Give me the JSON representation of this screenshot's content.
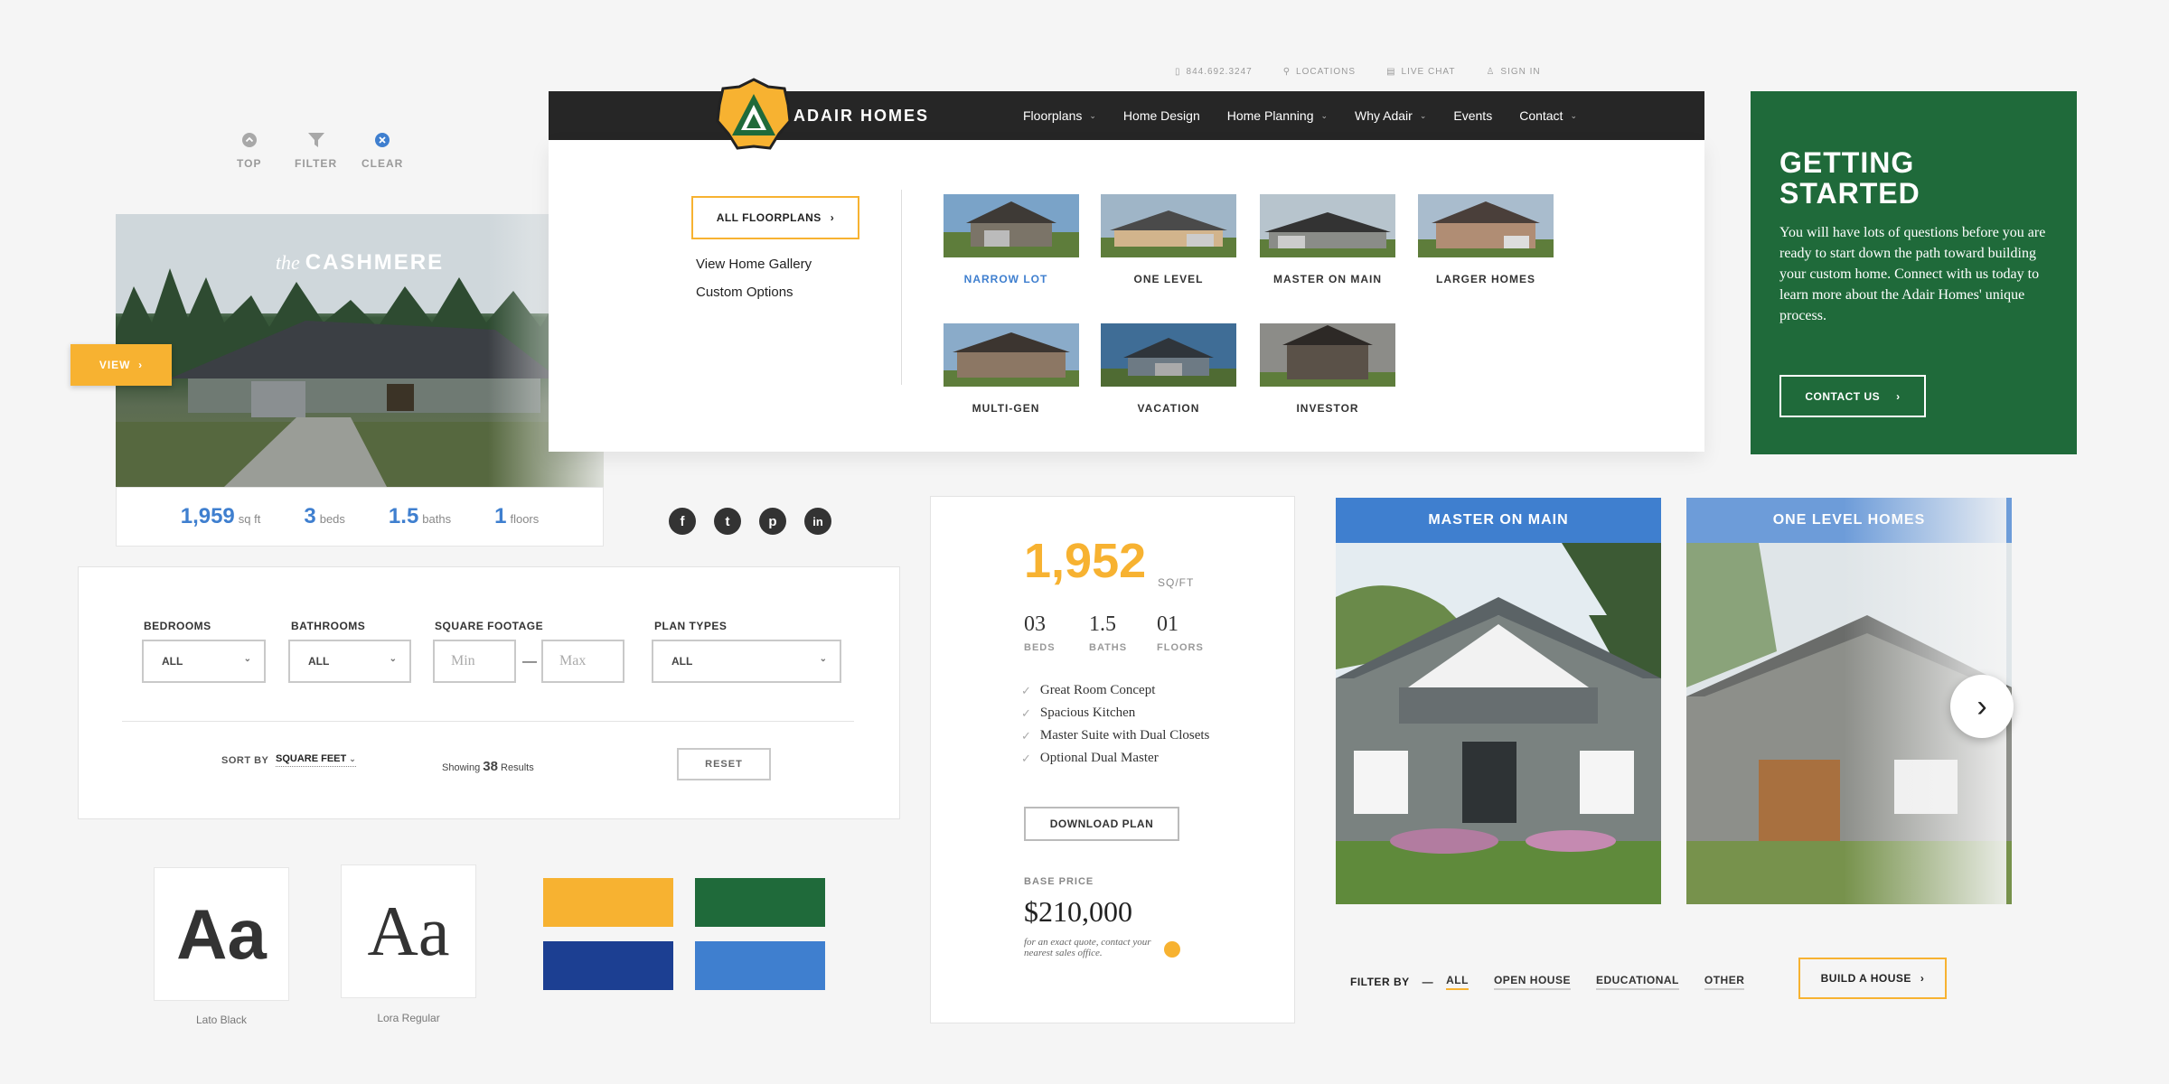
{
  "utility": {
    "top": "TOP",
    "filter": "FILTER",
    "clear": "CLEAR"
  },
  "cashmere": {
    "the": "the",
    "name": "CASHMERE",
    "view": "VIEW",
    "stats": [
      {
        "value": "1,959",
        "unit": "sq ft"
      },
      {
        "value": "3",
        "unit": "beds"
      },
      {
        "value": "1.5",
        "unit": "baths"
      },
      {
        "value": "1",
        "unit": "floors"
      }
    ]
  },
  "social": {
    "facebook": "f",
    "twitter": "t",
    "pinterest": "p",
    "linkedin": "in"
  },
  "filters": {
    "bedrooms_label": "BEDROOMS",
    "bedrooms_value": "ALL",
    "bathrooms_label": "BATHROOMS",
    "bathrooms_value": "ALL",
    "sqft_label": "SQUARE FOOTAGE",
    "min_placeholder": "Min",
    "max_placeholder": "Max",
    "dash": "—",
    "plan_types_label": "PLAN TYPES",
    "plan_types_value": "ALL",
    "sort_by_label": "SORT BY",
    "sort_by_value": "SQUARE FEET",
    "showing_label": "Showing",
    "showing_count": "38",
    "results_label": "Results",
    "reset": "RESET"
  },
  "typography": [
    {
      "sample": "Aa",
      "name": "Lato Black"
    },
    {
      "sample": "Aa",
      "name": "Lora Regular"
    }
  ],
  "colors": {
    "yellow": "#f7b231",
    "green": "#1f6a3a",
    "navy": "#1c3f92",
    "blue": "#3f7fcf"
  },
  "topbar": {
    "phone": "844.692.3247",
    "locations": "LOCATIONS",
    "live_chat": "LIVE CHAT",
    "sign_in": "SIGN IN"
  },
  "nav": {
    "logo": "ADAIR HOMES",
    "items": [
      "Floorplans",
      "Home Design",
      "Home Planning",
      "Why Adair",
      "Events",
      "Contact"
    ]
  },
  "menu": {
    "all_floorplans": "ALL FLOORPLANS",
    "links": [
      "View Home Gallery",
      "Custom Options"
    ],
    "categories": [
      "NARROW LOT",
      "ONE LEVEL",
      "MASTER ON MAIN",
      "LARGER HOMES",
      "MULTI-GEN",
      "VACATION",
      "INVESTOR"
    ]
  },
  "getting_started": {
    "title": "GETTING STARTED",
    "body": "You will have lots of questions before you are ready to start down the path toward building your custom home. Connect with us today to learn more about the Adair Homes' unique process.",
    "cta": "CONTACT US"
  },
  "plan": {
    "sqft": "1,952",
    "sqft_unit": "SQ/FT",
    "beds": "03",
    "beds_label": "BEDS",
    "baths": "1.5",
    "baths_label": "BATHS",
    "floors": "01",
    "floors_label": "FLOORS",
    "features": [
      "Great Room Concept",
      "Spacious Kitchen",
      "Master Suite with Dual Closets",
      "Optional Dual Master"
    ],
    "download": "DOWNLOAD PLAN",
    "base_price_label": "BASE PRICE",
    "base_price": "$210,000",
    "note": "for an exact quote, contact your nearest sales office."
  },
  "cards": [
    {
      "title": "MASTER ON MAIN"
    },
    {
      "title": "ONE LEVEL HOMES"
    }
  ],
  "filter_by": {
    "label": "FILTER BY",
    "dash": "—",
    "options": [
      "ALL",
      "OPEN HOUSE",
      "EDUCATIONAL",
      "OTHER"
    ],
    "active": "ALL"
  },
  "build": "BUILD A HOUSE"
}
